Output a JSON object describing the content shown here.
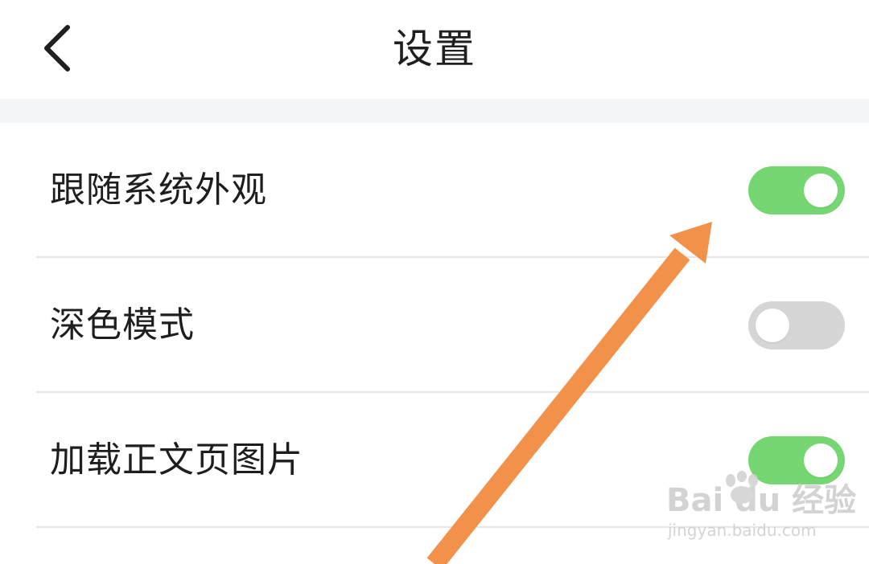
{
  "header": {
    "title": "设置",
    "back_icon": "chevron-left-icon"
  },
  "settings": [
    {
      "label": "跟随系统外观",
      "enabled": true
    },
    {
      "label": "深色模式",
      "enabled": false
    },
    {
      "label": "加载正文页图片",
      "enabled": true
    }
  ],
  "colors": {
    "toggle_on": "#76d672",
    "toggle_off": "#d6d6d6",
    "arrow": "#f2924a",
    "section_gap": "#f4f5f6"
  },
  "watermark": {
    "brand": "Bai  du 经验",
    "url": "jingyan.baidu.com"
  }
}
